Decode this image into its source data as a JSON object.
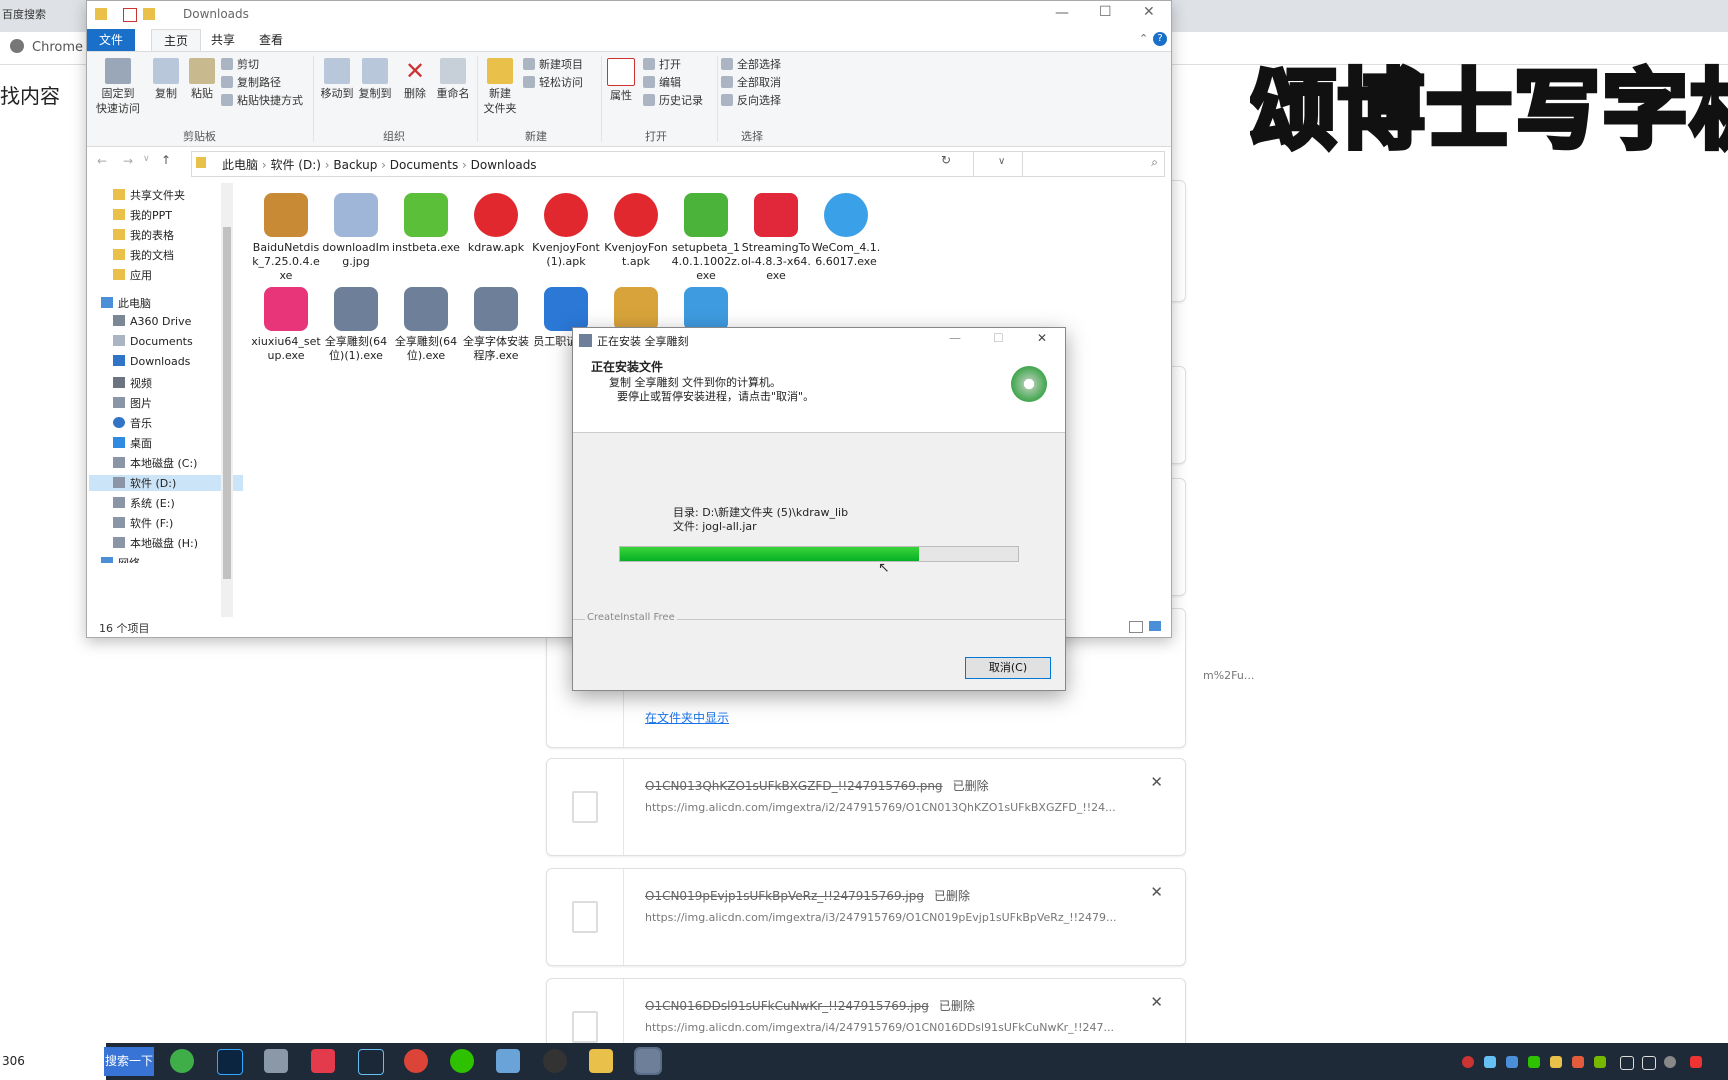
{
  "chrome": {
    "tab_text": "百度搜索",
    "app_label": "Chrome",
    "side_text": "找内容"
  },
  "overlay_title": "颂博士写字机",
  "downloads": [
    {
      "name": "",
      "url": "m%2Fu...",
      "link": "在文件夹中显示"
    },
    {
      "name": "O1CN013QhKZO1sUFkBXGZFD_!!247915769.png",
      "status": "已删除",
      "url": "https://img.alicdn.com/imgextra/i2/247915769/O1CN013QhKZO1sUFkBXGZFD_!!24..."
    },
    {
      "name": "O1CN019pEvjp1sUFkBpVeRz_!!247915769.jpg",
      "status": "已删除",
      "url": "https://img.alicdn.com/imgextra/i3/247915769/O1CN019pEvjp1sUFkBpVeRz_!!2479..."
    },
    {
      "name": "O1CN016DDsl91sUFkCuNwKr_!!247915769.jpg",
      "status": "已删除",
      "url": "https://img.alicdn.com/imgextra/i4/247915769/O1CN016DDsl91sUFkCuNwKr_!!247..."
    }
  ],
  "explorer": {
    "title": "Downloads",
    "tabs": {
      "file": "文件",
      "home": "主页",
      "share": "共享",
      "view": "查看"
    },
    "ribbon": {
      "pin": "固定到\n快速访问",
      "copy": "复制",
      "paste": "粘贴",
      "cut": "剪切",
      "copy_path": "复制路径",
      "paste_shortcut": "粘贴快捷方式",
      "move_to": "移动到",
      "copy_to": "复制到",
      "delete": "删除",
      "rename": "重命名",
      "new_folder": "新建\n文件夹",
      "new_item": "新建项目",
      "easy_access": "轻松访问",
      "properties": "属性",
      "open": "打开",
      "edit": "编辑",
      "history": "历史记录",
      "select_all": "全部选择",
      "select_none": "全部取消",
      "invert": "反向选择",
      "groups": {
        "clipboard": "剪贴板",
        "organize": "组织",
        "new": "新建",
        "open": "打开",
        "select": "选择"
      }
    },
    "breadcrumb": [
      "此电脑",
      "软件 (D:)",
      "Backup",
      "Documents",
      "Downloads"
    ],
    "nav": [
      "共享文件夹",
      "我的PPT",
      "我的表格",
      "我的文档",
      "应用",
      "此电脑",
      "A360 Drive",
      "Documents",
      "Downloads",
      "视频",
      "图片",
      "音乐",
      "桌面",
      "本地磁盘 (C:)",
      "软件 (D:)",
      "系统 (E:)",
      "软件 (F:)",
      "本地磁盘 (H:)",
      "网络"
    ],
    "files": [
      {
        "name": "BaiduNetdisk_7.25.0.4.exe",
        "color": "#c98a36"
      },
      {
        "name": "downloadImg.jpg",
        "color": "#9fb6d8"
      },
      {
        "name": "instbeta.exe",
        "color": "#5cbf3a"
      },
      {
        "name": "kdraw.apk",
        "color": "#e0282e"
      },
      {
        "name": "KvenjoyFont (1).apk",
        "color": "#e0282e"
      },
      {
        "name": "KvenjoyFont.apk",
        "color": "#e0282e"
      },
      {
        "name": "setupbeta_14.0.1.1002z.exe",
        "color": "#4bb33a"
      },
      {
        "name": "StreamingTool-4.8.3-x64.exe",
        "color": "#e0283a"
      },
      {
        "name": "WeCom_4.1.6.6017.exe",
        "color": "#3aa0e8"
      },
      {
        "name": "xiuxiu64_setup.exe",
        "color": "#e8357a"
      },
      {
        "name": "全享雕刻(64位)(1).exe",
        "color": "#6d7f99"
      },
      {
        "name": "全享雕刻(64位).exe",
        "color": "#6d7f99"
      },
      {
        "name": "全享字体安装程序.exe",
        "color": "#6d7f99"
      },
      {
        "name": "员工职证版.d",
        "color": "#2b78d6"
      },
      {
        "name": "",
        "color": "#d8a33a"
      },
      {
        "name": "",
        "color": "#3f9be0"
      }
    ],
    "item_count": "16 个项目"
  },
  "installer": {
    "title": "正在安装 全享雕刻",
    "heading": "正在安装文件",
    "subheading": "复制 全享雕刻 文件到你的计算机。",
    "instruction": "要停止或暂停安装进程，请点击\"取消\"。",
    "dir_label": "目录: D:\\新建文件夹 (5)\\kdraw_lib",
    "file_label": "文件: jogl-all.jar",
    "progress_pct": 75,
    "footer_brand": "CreateInstall Free",
    "cancel_label": "取消(C)"
  },
  "taskbar": {
    "search_text": "306",
    "search_button": "搜索一下"
  }
}
